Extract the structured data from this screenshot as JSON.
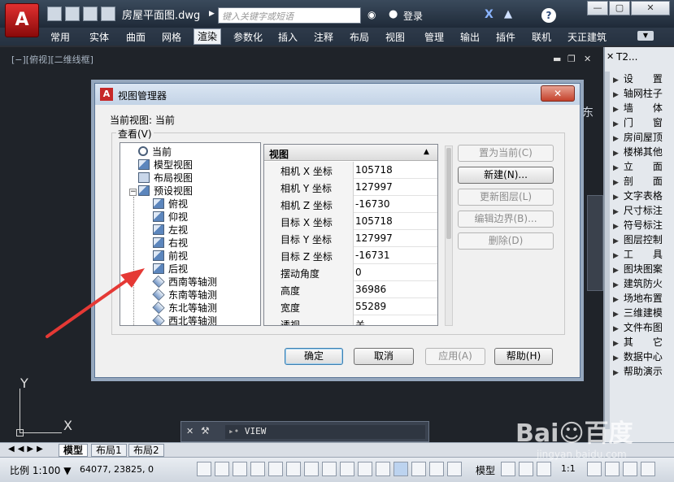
{
  "titlebar": {
    "app_logo": "A",
    "document_title": "房屋平面图.dwg",
    "search_placeholder": "键入关键字或短语",
    "login_label": "登录",
    "help_icon": "?",
    "window_minimize": "—",
    "window_restore": "▢",
    "window_close": "✕"
  },
  "ribbon_tabs": [
    {
      "label": "常用"
    },
    {
      "label": "实体"
    },
    {
      "label": "曲面"
    },
    {
      "label": "网格"
    },
    {
      "label": "渲染",
      "active": true
    },
    {
      "label": "参数化"
    },
    {
      "label": "插入"
    },
    {
      "label": "注释"
    },
    {
      "label": "布局"
    },
    {
      "label": "视图"
    },
    {
      "label": "管理"
    },
    {
      "label": "输出"
    },
    {
      "label": "插件"
    },
    {
      "label": "联机"
    },
    {
      "label": "天正建筑"
    }
  ],
  "viewport": {
    "label": "[−][俯视][二维线框]",
    "compass_label": "东",
    "ucs_x": "X",
    "ucs_y": "Y"
  },
  "dialog": {
    "title": "视图管理器",
    "icon_letter": "A",
    "close_label": "✕",
    "current_view_label": "当前视图:",
    "current_view_value": "当前",
    "query_label": "查看(V)",
    "tree": [
      {
        "label": "当前",
        "icon": "magnifier-icon"
      },
      {
        "label": "模型视图",
        "icon": "model-view-icon"
      },
      {
        "label": "布局视图",
        "icon": "layout-view-icon"
      },
      {
        "label": "预设视图",
        "icon": "preset-view-icon"
      },
      {
        "label": "俯视",
        "icon": "top-view-icon"
      },
      {
        "label": "仰视",
        "icon": "bottom-view-icon"
      },
      {
        "label": "左视",
        "icon": "left-view-icon"
      },
      {
        "label": "右视",
        "icon": "right-view-icon"
      },
      {
        "label": "前视",
        "icon": "front-view-icon"
      },
      {
        "label": "后视",
        "icon": "back-view-icon"
      },
      {
        "label": "西南等轴测",
        "icon": "sw-iso-icon"
      },
      {
        "label": "东南等轴测",
        "icon": "se-iso-icon"
      },
      {
        "label": "东北等轴测",
        "icon": "ne-iso-icon"
      },
      {
        "label": "西北等轴测",
        "icon": "nw-iso-icon"
      }
    ],
    "props_header": "视图",
    "props": [
      {
        "name": "相机 X 坐标",
        "value": "105718"
      },
      {
        "name": "相机 Y 坐标",
        "value": "127997"
      },
      {
        "name": "相机 Z 坐标",
        "value": "-16730"
      },
      {
        "name": "目标 X 坐标",
        "value": "105718"
      },
      {
        "name": "目标 Y 坐标",
        "value": "127997"
      },
      {
        "name": "目标 Z 坐标",
        "value": "-16731"
      },
      {
        "name": "摆动角度",
        "value": "0"
      },
      {
        "name": "高度",
        "value": "36986"
      },
      {
        "name": "宽度",
        "value": "55289"
      },
      {
        "name": "透视",
        "value": "关"
      }
    ],
    "side_buttons": [
      {
        "label": "置为当前(C)",
        "enabled": false
      },
      {
        "label": "新建(N)...",
        "enabled": true
      },
      {
        "label": "更新图层(L)",
        "enabled": false
      },
      {
        "label": "编辑边界(B)...",
        "enabled": false
      },
      {
        "label": "删除(D)",
        "enabled": false
      }
    ],
    "bottom_buttons": {
      "ok": "确定",
      "cancel": "取消",
      "apply": "应用(A)",
      "help": "帮助(H)"
    }
  },
  "command_line": {
    "value": "VIEW"
  },
  "layout_tabs": [
    {
      "label": "模型",
      "active": true
    },
    {
      "label": "布局1"
    },
    {
      "label": "布局2"
    }
  ],
  "statusbar": {
    "scale": "比例 1:100",
    "coords": "64077, 23825, 0",
    "model": "模型",
    "zoom": "1:1"
  },
  "palette": {
    "title": "T2...",
    "items": [
      "设　　置",
      "轴网柱子",
      "墙　　体",
      "门　　窗",
      "房间屋顶",
      "楼梯其他",
      "立　　面",
      "剖　　面",
      "文字表格",
      "尺寸标注",
      "符号标注",
      "图层控制",
      "工　　具",
      "图块图案",
      "建筑防火",
      "场地布置",
      "三维建模",
      "文件布图",
      "其　　它",
      "数据中心",
      "帮助演示"
    ]
  },
  "watermark": {
    "text": "Bai☺百度",
    "sub": "jingyan.baidu.com"
  }
}
